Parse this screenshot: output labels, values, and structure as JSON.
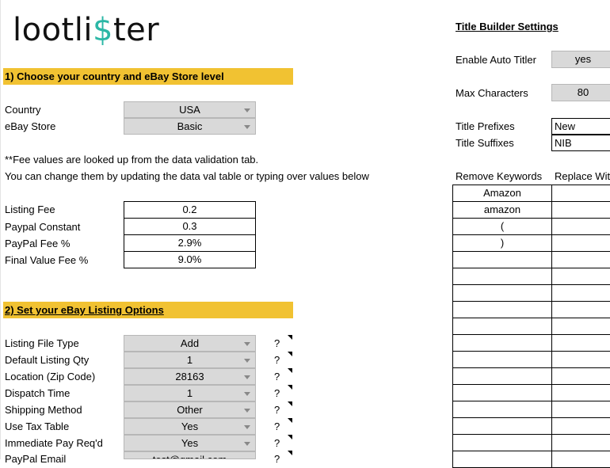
{
  "logo": {
    "part1": "loot",
    "part2": "li",
    "accent": "$",
    "part3": "ter",
    "accent_color": "#2bb7a6"
  },
  "sections": {
    "s1": "1) Choose your country and eBay Store level",
    "s2": "2) Set your eBay Listing Options"
  },
  "country": {
    "label": "Country",
    "value": "USA"
  },
  "store": {
    "label": "eBay Store",
    "value": "Basic"
  },
  "notes": {
    "line1": "**Fee values are looked up from the data validation tab.",
    "line2": "You can change them by updating the data val table or typing over values below"
  },
  "fees": [
    {
      "label": "Listing Fee",
      "value": "0.2"
    },
    {
      "label": "Paypal Constant",
      "value": "0.3"
    },
    {
      "label": "PayPal Fee %",
      "value": "2.9%"
    },
    {
      "label": "Final Value Fee %",
      "value": "9.0%"
    }
  ],
  "options": [
    {
      "label": "Listing File Type",
      "value": "Add",
      "help": "?"
    },
    {
      "label": "Default Listing Qty",
      "value": "1",
      "help": "?"
    },
    {
      "label": "Location (Zip Code)",
      "value": "28163",
      "help": "?"
    },
    {
      "label": "Dispatch Time",
      "value": "1",
      "help": "?"
    },
    {
      "label": "Shipping Method",
      "value": "Other",
      "help": "?"
    },
    {
      "label": "Use Tax Table",
      "value": "Yes",
      "help": "?"
    },
    {
      "label": "Immediate Pay Req'd",
      "value": "Yes",
      "help": "?"
    },
    {
      "label": "PayPal Email",
      "value": "test@gmail.com",
      "help": "?"
    }
  ],
  "title_builder": {
    "heading": "Title Builder Settings",
    "auto_titler": {
      "label": "Enable Auto Titler",
      "value": "yes"
    },
    "max_chars": {
      "label": "Max Characters",
      "value": "80"
    },
    "prefixes": {
      "label": "Title Prefixes",
      "value": "New"
    },
    "suffixes": {
      "label": "Title Suffixes",
      "value": "NIB"
    },
    "remove_header": "Remove Keywords",
    "replace_header": "Replace With",
    "keywords": [
      "Amazon",
      "amazon",
      "(",
      ")",
      "",
      "",
      "",
      "",
      "",
      "",
      "",
      "",
      "",
      "",
      "",
      "",
      ""
    ]
  }
}
